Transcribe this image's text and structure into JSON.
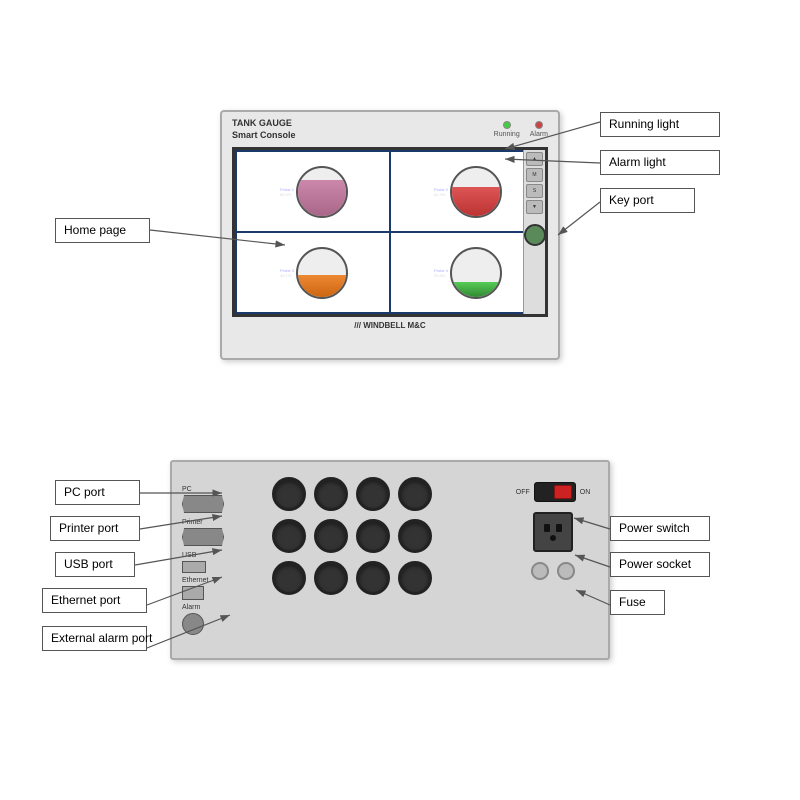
{
  "device_top": {
    "title_line1": "TANK GAUGE",
    "title_line2": "Smart Console",
    "running_label": "Running",
    "alarm_label": "Alarm",
    "logo": "/// WINDBELL M&C",
    "brand": "WINDBELL M&C"
  },
  "labels": {
    "running_light": "Running light",
    "alarm_light": "Alarm light",
    "key_port": "Key port",
    "home_page": "Home page",
    "pc_port": "PC port",
    "printer_port": "Printer port",
    "usb_port": "USB port",
    "ethernet_port": "Ethernet port",
    "external_alarm": "External alarm port",
    "power_switch": "Power switch",
    "power_socket": "Power socket",
    "fuse": "Fuse"
  },
  "back_panel": {
    "pc": "PC",
    "printer": "Printer",
    "usb": "USB",
    "ethernet": "Ethernet",
    "alarm": "Alarm",
    "off": "OFF",
    "on": "ON"
  }
}
